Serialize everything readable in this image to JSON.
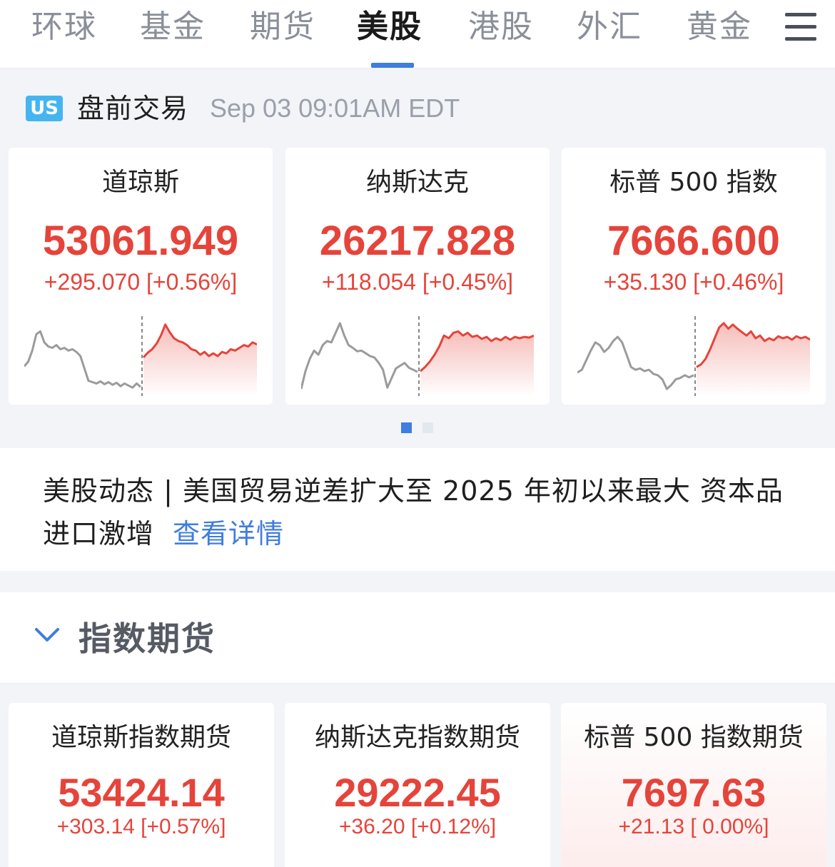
{
  "tabs": [
    {
      "label": "环球",
      "active": false
    },
    {
      "label": "基金",
      "active": false
    },
    {
      "label": "期货",
      "active": false
    },
    {
      "label": "美股",
      "active": true
    },
    {
      "label": "港股",
      "active": false
    },
    {
      "label": "外汇",
      "active": false
    },
    {
      "label": "黄金",
      "active": false
    }
  ],
  "menu_icon": "hamburger-menu-icon",
  "market": {
    "badge": "US",
    "session": "盘前交易",
    "time": "Sep 03 09:01AM EDT"
  },
  "indices": [
    {
      "name": "道琼斯",
      "price": "53061.949",
      "change": "+295.070 [+0.56%]",
      "sparkline": {
        "pre": [
          0.35,
          0.42,
          0.58,
          0.82,
          0.86,
          0.7,
          0.64,
          0.62,
          0.66,
          0.6,
          0.62,
          0.58,
          0.6,
          0.56,
          0.5,
          0.32,
          0.14,
          0.12,
          0.1,
          0.13,
          0.09,
          0.12,
          0.08,
          0.11,
          0.06,
          0.1,
          0.07,
          0.04,
          0.1,
          0.05
        ],
        "post": [
          0.48,
          0.55,
          0.6,
          0.68,
          0.8,
          0.96,
          0.85,
          0.76,
          0.72,
          0.7,
          0.66,
          0.6,
          0.58,
          0.52,
          0.56,
          0.5,
          0.54,
          0.5,
          0.56,
          0.54,
          0.6,
          0.58,
          0.62,
          0.66,
          0.64,
          0.7,
          0.67
        ]
      }
    },
    {
      "name": "纳斯达克",
      "price": "26217.828",
      "change": "+118.054 [+0.45%]",
      "sparkline": {
        "pre": [
          0.02,
          0.28,
          0.46,
          0.58,
          0.52,
          0.66,
          0.72,
          0.7,
          0.84,
          0.98,
          0.8,
          0.66,
          0.62,
          0.57,
          0.58,
          0.54,
          0.5,
          0.48,
          0.4,
          0.3,
          0.04,
          0.18,
          0.32,
          0.36,
          0.4,
          0.33,
          0.3,
          0.27
        ],
        "post": [
          0.28,
          0.34,
          0.42,
          0.52,
          0.64,
          0.8,
          0.76,
          0.84,
          0.86,
          0.8,
          0.84,
          0.78,
          0.8,
          0.75,
          0.78,
          0.72,
          0.76,
          0.73,
          0.78,
          0.74,
          0.78,
          0.76,
          0.78,
          0.77,
          0.8
        ]
      }
    },
    {
      "name": "标普 500 指数",
      "price": "7666.600",
      "change": "+35.130 [+0.46%]",
      "sparkline": {
        "pre": [
          0.26,
          0.3,
          0.44,
          0.58,
          0.7,
          0.66,
          0.56,
          0.62,
          0.72,
          0.78,
          0.7,
          0.52,
          0.34,
          0.3,
          0.32,
          0.28,
          0.3,
          0.24,
          0.22,
          0.16,
          0.02,
          0.08,
          0.16,
          0.18,
          0.22,
          0.19,
          0.22
        ],
        "post": [
          0.34,
          0.38,
          0.46,
          0.6,
          0.76,
          0.92,
          0.98,
          0.9,
          0.96,
          0.9,
          0.85,
          0.8,
          0.86,
          0.76,
          0.8,
          0.72,
          0.76,
          0.73,
          0.79,
          0.76,
          0.78,
          0.74,
          0.79,
          0.76,
          0.78,
          0.74
        ]
      }
    }
  ],
  "pager": {
    "total": 2,
    "current": 1
  },
  "news": {
    "text": "美股动态 | 美国贸易逆差扩大至 2025 年初以来最大 资本品进口激增",
    "link": "查看详情"
  },
  "futures_section": {
    "title": "指数期货",
    "collapse_icon": "chevron-down-icon"
  },
  "futures": [
    {
      "name": "道琼斯指数期货",
      "price": "53424.14",
      "change": "+303.14 [+0.57%]"
    },
    {
      "name": "纳斯达克指数期货",
      "price": "29222.45",
      "change": "+36.20 [+0.12%]"
    },
    {
      "name": "标普 500 指数期货",
      "price": "7697.63",
      "change": "+21.13 [ 0.00%]"
    }
  ],
  "colors": {
    "up": "#e5443b",
    "accent": "#3f7de0",
    "pre_line": "#9b9b9b",
    "badge": "#45b5f0"
  }
}
